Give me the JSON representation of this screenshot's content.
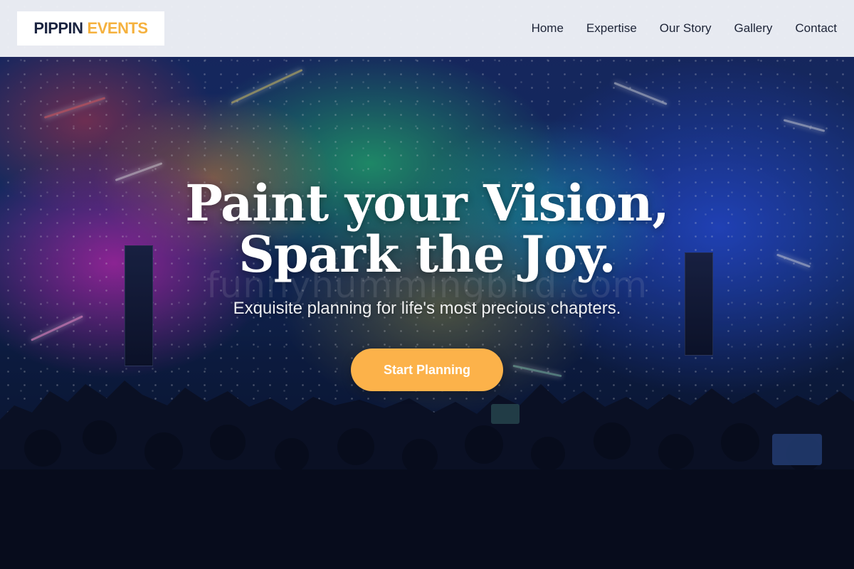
{
  "header": {
    "logo_part1": "PIPPIN",
    "logo_part2": "EVENTS",
    "logo_accent_color": "#f5b13e",
    "nav": [
      {
        "label": "Home"
      },
      {
        "label": "Expertise"
      },
      {
        "label": "Our Story"
      },
      {
        "label": "Gallery"
      },
      {
        "label": "Contact"
      }
    ]
  },
  "hero": {
    "headline": "Paint your Vision, Spark the Joy.",
    "subheadline": "Exquisite planning for life's most precious chapters.",
    "cta_label": "Start Planning",
    "cta_color": "#fcb24a",
    "watermark": "funnyhummingbird.com",
    "background": "concert-crowd-photo"
  }
}
